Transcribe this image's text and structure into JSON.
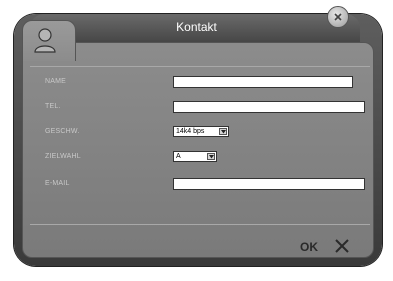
{
  "window": {
    "title": "Kontakt",
    "close_icon": "close-icon",
    "user_icon": "user-icon"
  },
  "form": {
    "fields": [
      {
        "label": "NAME",
        "value": ""
      },
      {
        "label": "TEL.",
        "value": ""
      },
      {
        "label": "GESCHW.",
        "value": "14k4 bps"
      },
      {
        "label": "ZIELWAHL",
        "value": "A"
      },
      {
        "label": "E-MAIL",
        "value": ""
      }
    ]
  },
  "footer": {
    "ok_label": "OK",
    "cancel_icon": "x-icon"
  }
}
